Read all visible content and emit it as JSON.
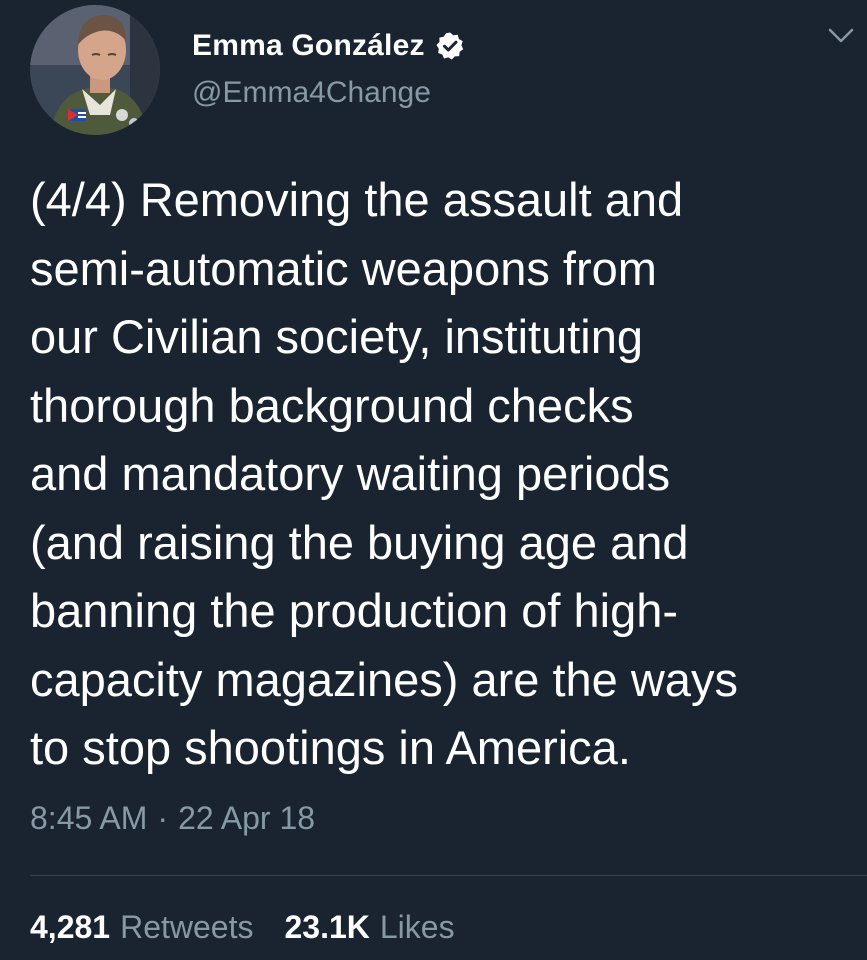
{
  "author": {
    "display_name": "Emma González",
    "handle": "@Emma4Change",
    "verified": true,
    "avatar_icon": "profile-photo"
  },
  "tweet": {
    "text_lines": [
      "(4/4) Removing the assault and",
      "semi-automatic weapons from",
      "our Civilian society, instituting",
      "thorough background checks",
      "and mandatory waiting periods",
      "(and raising the buying age and",
      "banning the production of high-",
      "capacity magazines) are the ways",
      "to stop shootings in America."
    ],
    "time": "8:45 AM",
    "separator": "·",
    "date": "22 Apr 18"
  },
  "stats": {
    "retweets_count": "4,281",
    "retweets_label": "Retweets",
    "likes_count": "23.1K",
    "likes_label": "Likes"
  },
  "colors": {
    "background": "#1a2330",
    "text_primary": "#ffffff",
    "text_secondary": "#8899a6",
    "divider": "#38444d"
  },
  "icons": {
    "verified": "verified-badge-icon",
    "menu": "chevron-down-icon"
  }
}
